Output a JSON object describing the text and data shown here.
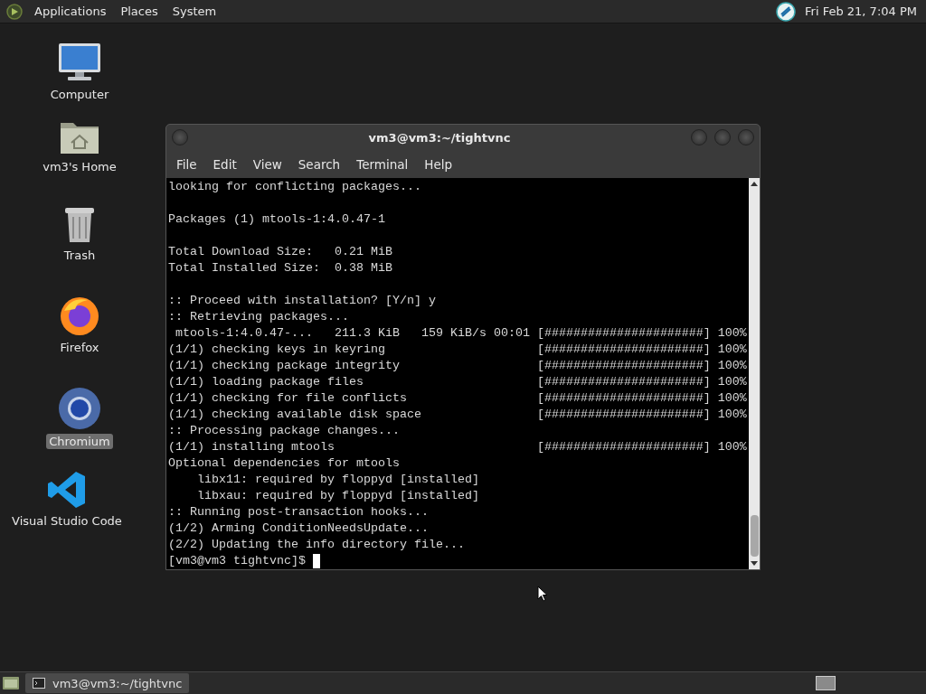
{
  "top_panel": {
    "menus": [
      "Applications",
      "Places",
      "System"
    ],
    "clock": "Fri Feb 21, 7:04 PM"
  },
  "desktop_icons": [
    {
      "kind": "computer",
      "label": "Computer",
      "selected": false
    },
    {
      "kind": "home",
      "label": "vm3's Home",
      "selected": false
    },
    {
      "kind": "trash",
      "label": "Trash",
      "selected": false
    },
    {
      "kind": "firefox",
      "label": "Firefox",
      "selected": false
    },
    {
      "kind": "chromium",
      "label": "Chromium",
      "selected": true
    },
    {
      "kind": "vscode",
      "label": "Visual Studio Code",
      "selected": false
    }
  ],
  "window": {
    "title": "vm3@vm3:~/tightvnc",
    "menus": [
      "File",
      "Edit",
      "View",
      "Search",
      "Terminal",
      "Help"
    ],
    "terminal_blocks": [
      [
        "looking for conflicting packages..."
      ],
      [
        "Packages (1) mtools-1:4.0.47-1"
      ],
      [
        "Total Download Size:   0.21 MiB",
        "Total Installed Size:  0.38 MiB"
      ],
      [
        ":: Proceed with installation? [Y/n] y",
        ":: Retrieving packages...",
        " mtools-1:4.0.47-...   211.3 KiB   159 KiB/s 00:01 [######################] 100%",
        "(1/1) checking keys in keyring                     [######################] 100%",
        "(1/1) checking package integrity                   [######################] 100%",
        "(1/1) loading package files                        [######################] 100%",
        "(1/1) checking for file conflicts                  [######################] 100%",
        "(1/1) checking available disk space                [######################] 100%",
        ":: Processing package changes...",
        "(1/1) installing mtools                            [######################] 100%",
        "Optional dependencies for mtools",
        "    libx11: required by floppyd [installed]",
        "    libxau: required by floppyd [installed]",
        ":: Running post-transaction hooks...",
        "(1/2) Arming ConditionNeedsUpdate...",
        "(2/2) Updating the info directory file..."
      ]
    ],
    "prompt": "[vm3@vm3 tightvnc]$ "
  },
  "bottom_panel": {
    "tasks": [
      {
        "label": "vm3@vm3:~/tightvnc",
        "selected": true
      }
    ]
  }
}
